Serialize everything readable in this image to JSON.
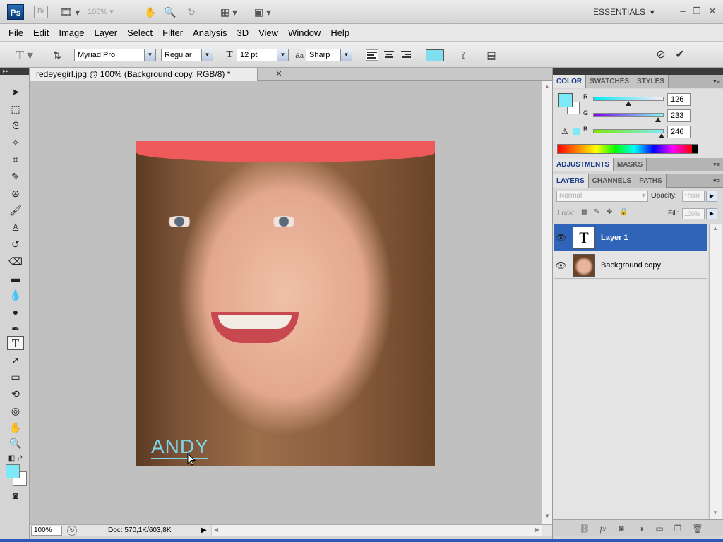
{
  "app": {
    "logo": "Ps",
    "bridge": "Br",
    "zoom_dropdown": "100%",
    "workspace": "ESSENTIALS"
  },
  "menu": [
    "File",
    "Edit",
    "Image",
    "Layer",
    "Select",
    "Filter",
    "Analysis",
    "3D",
    "View",
    "Window",
    "Help"
  ],
  "options_bar": {
    "font_family": "Myriad Pro",
    "font_style": "Regular",
    "font_size": "12 pt",
    "antialias_prefix": "a",
    "antialias_suffix": "a",
    "antialias": "Sharp",
    "text_color": "#7fdff0"
  },
  "document": {
    "tab_title": "redeyegirl.jpg @ 100% (Background copy, RGB/8) *",
    "text_layer_content": "ANDY",
    "zoom": "100%",
    "doc_info": "Doc: 570,1K/603,8K"
  },
  "color_panel": {
    "tabs": [
      "COLOR",
      "SWATCHES",
      "STYLES"
    ],
    "channels": [
      {
        "label": "R",
        "value": "126",
        "fraction": 0.49
      },
      {
        "label": "G",
        "value": "233",
        "fraction": 0.91
      },
      {
        "label": "B",
        "value": "246",
        "fraction": 0.96
      }
    ],
    "foreground": "#7ee9f6",
    "background": "#ffffff"
  },
  "adjustments_panel": {
    "tabs": [
      "ADJUSTMENTS",
      "MASKS"
    ]
  },
  "layers_panel": {
    "tabs": [
      "LAYERS",
      "CHANNELS",
      "PATHS"
    ],
    "blend_mode": "Normal",
    "opacity_label": "Opacity:",
    "opacity_value": "100%",
    "lock_label": "Lock:",
    "fill_label": "Fill:",
    "fill_value": "100%",
    "layers": [
      {
        "name": "Layer 1",
        "thumb_text": "T",
        "selected": true
      },
      {
        "name": "Background copy",
        "thumb_text": "",
        "selected": false
      }
    ]
  },
  "colors": {
    "accent_selection": "#2f64b8",
    "hat": "#ee5a5a",
    "text_layer": "#7fd6ea"
  }
}
